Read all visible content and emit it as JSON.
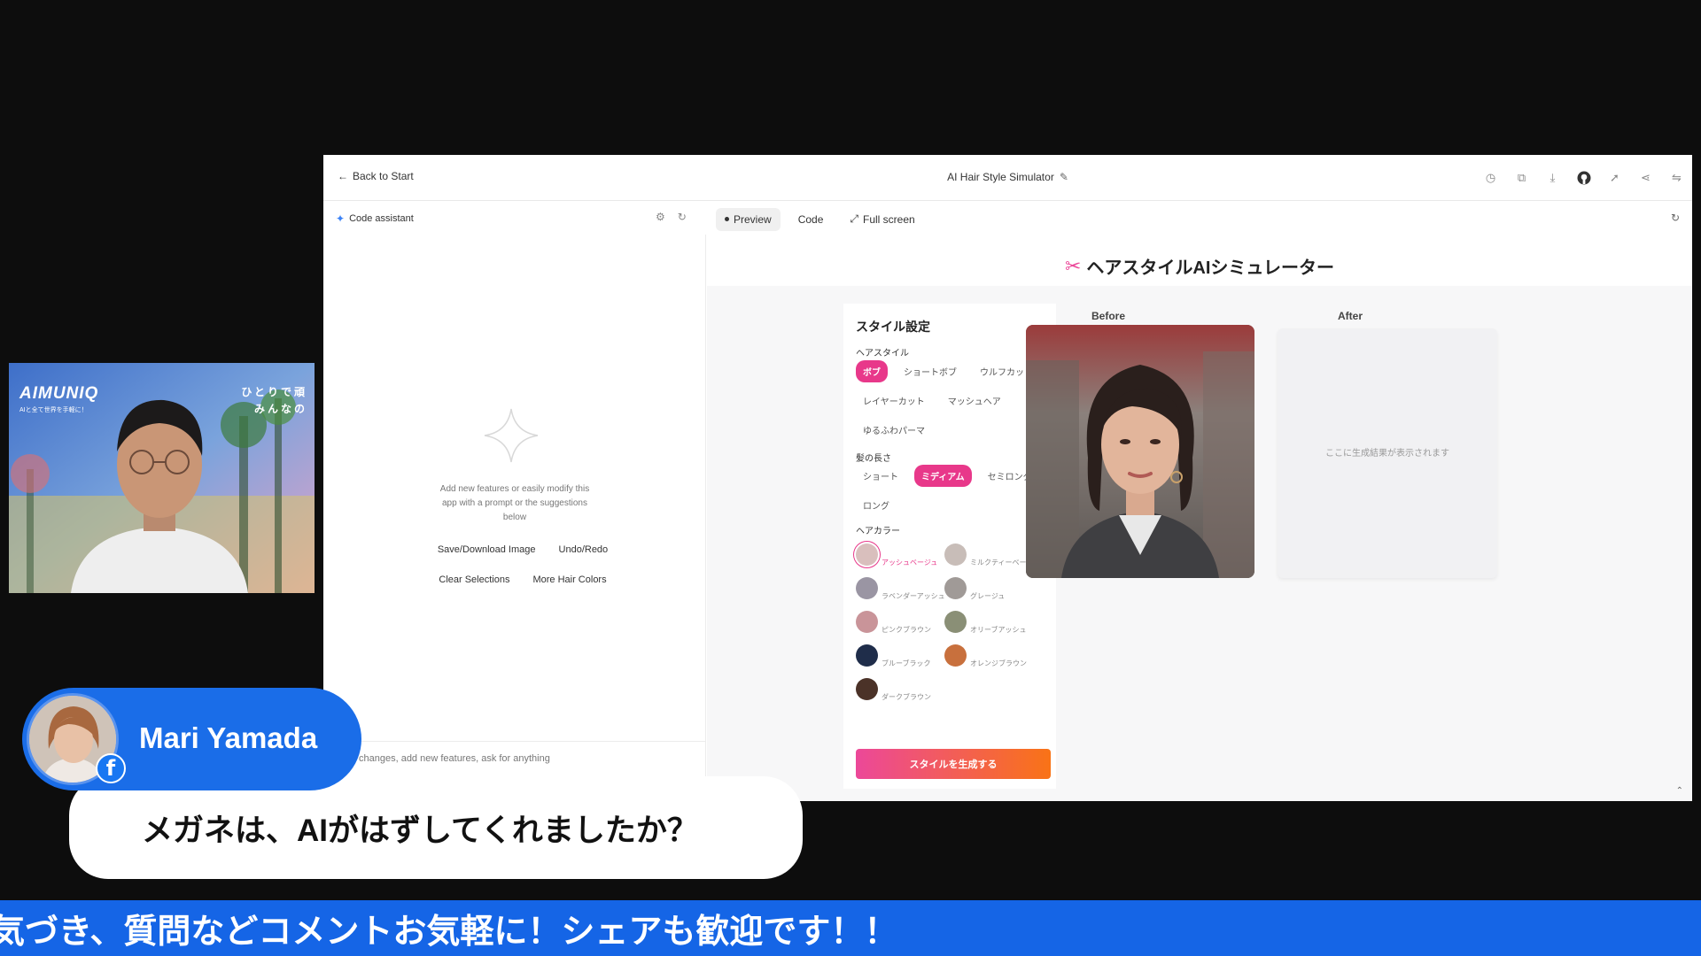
{
  "window": {
    "back_label": "Back to Start",
    "app_title": "AI Hair Style Simulator",
    "code_assistant": "Code assistant",
    "tabs": [
      {
        "label": "Preview",
        "active": true
      },
      {
        "label": "Code"
      },
      {
        "label": "Full screen"
      }
    ]
  },
  "chat": {
    "hint": "Add new features or easily modify this app with a prompt or the suggestions below",
    "suggestions": [
      "Save/Download Image",
      "Undo/Redo",
      "Clear Selections",
      "More Hair Colors"
    ],
    "input_placeholder": "changes, add new features, ask for anything"
  },
  "app": {
    "title": "ヘアスタイルAIシミュレーター",
    "panel_title": "スタイル設定",
    "hairstyle_label": "ヘアスタイル",
    "hairstyles": [
      {
        "label": "ボブ",
        "selected": true
      },
      {
        "label": "ショートボブ"
      },
      {
        "label": "ウルフカット"
      },
      {
        "label": "レイヤーカット"
      },
      {
        "label": "マッシュヘア"
      },
      {
        "label": "ゆるふわパーマ"
      }
    ],
    "length_label": "髪の長さ",
    "lengths": [
      {
        "label": "ショート"
      },
      {
        "label": "ミディアム",
        "selected": true
      },
      {
        "label": "セミロング"
      },
      {
        "label": "ロング"
      }
    ],
    "color_label": "ヘアカラー",
    "colors": [
      {
        "name": "アッシュベージュ",
        "hex": "#d9bfbd",
        "selected": true
      },
      {
        "name": "ミルクティーベージュ",
        "hex": "#c8bdb8"
      },
      {
        "name": "ラベンダーアッシュ",
        "hex": "#9a95a3"
      },
      {
        "name": "グレージュ",
        "hex": "#a09a97"
      },
      {
        "name": "ピンクブラウン",
        "hex": "#c99499"
      },
      {
        "name": "オリーブアッシュ",
        "hex": "#8a8f76"
      },
      {
        "name": "ブルーブラック",
        "hex": "#1f2d4a"
      },
      {
        "name": "オレンジブラウン",
        "hex": "#c8703d"
      },
      {
        "name": "ダークブラウン",
        "hex": "#4b3228"
      }
    ],
    "generate_label": "スタイルを生成する",
    "before_label": "Before",
    "after_label": "After",
    "after_placeholder": "ここに生成結果が表示されます"
  },
  "webcam": {
    "brand": "AIMUNIQ",
    "tagline": "AIと全て世界を手軽に！",
    "slogan_line1": "ひとりで頑",
    "slogan_line2": "みんなの"
  },
  "comment": {
    "name": "Mari Yamada",
    "text": "メガネは、AIがはずしてくれましたか？"
  },
  "ticker": "気づき、質問などコメントお気軽に！シェアも歓迎です！！",
  "accent": {
    "pink": "#e8388a",
    "blue": "#1565e6"
  }
}
